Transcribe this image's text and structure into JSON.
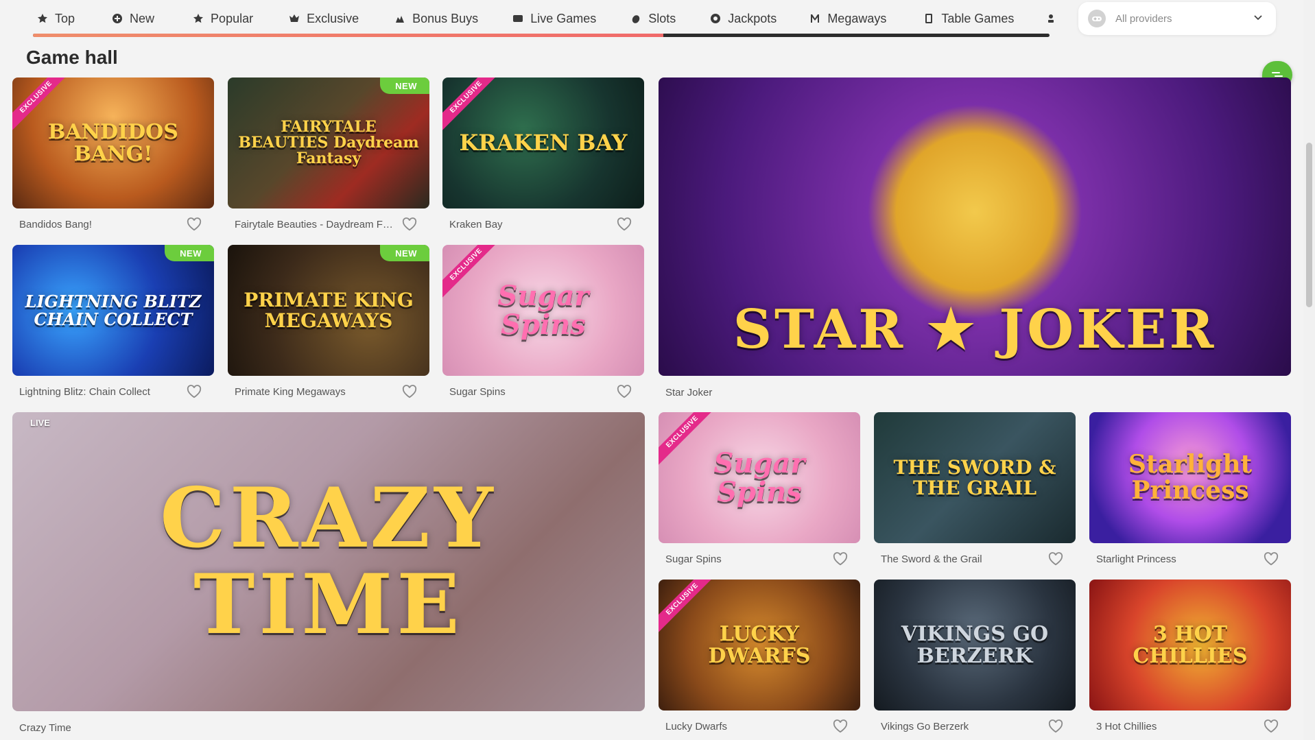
{
  "nav": {
    "tabs": [
      {
        "label": "Top",
        "icon": "star-icon"
      },
      {
        "label": "New",
        "icon": "plus-circle-icon"
      },
      {
        "label": "Popular",
        "icon": "star-icon"
      },
      {
        "label": "Exclusive",
        "icon": "crown-icon"
      },
      {
        "label": "Bonus Buys",
        "icon": "sparkle-icon"
      },
      {
        "label": "Live Games",
        "icon": "camera-icon"
      },
      {
        "label": "Slots",
        "icon": "cherry-icon"
      },
      {
        "label": "Jackpots",
        "icon": "chip-icon"
      },
      {
        "label": "Megaways",
        "icon": "m-icon"
      },
      {
        "label": "Table Games",
        "icon": "card-icon"
      }
    ],
    "progress": 0.62,
    "provider_select": {
      "value": "All providers"
    }
  },
  "heading": "Game hall",
  "badges": {
    "new": "NEW",
    "exclusive": "EXCLUSIVE",
    "live": "LIVE"
  },
  "games": {
    "bandidos": {
      "title": "Bandidos Bang!",
      "art": "BANDIDOS BANG!"
    },
    "fairytale": {
      "title": "Fairytale Beauties - Daydream Fantasy",
      "art": "FAIRYTALE BEAUTIES Daydream Fantasy"
    },
    "kraken": {
      "title": "Kraken Bay",
      "art": "KRAKEN BAY"
    },
    "lightning": {
      "title": "Lightning Blitz: Chain Collect",
      "art": "LIGHTNING BLITZ CHAIN COLLECT"
    },
    "primate": {
      "title": "Primate King Megaways",
      "art": "PRIMATE KING MEGAWAYS"
    },
    "sugar1": {
      "title": "Sugar Spins",
      "art": "Sugar Spins"
    },
    "starjoker": {
      "title": "Star Joker",
      "art": "STAR ★ JOKER"
    },
    "crazytime": {
      "title": "Crazy Time",
      "art": "CRAZY TIME"
    },
    "sugar2": {
      "title": "Sugar Spins",
      "art": "Sugar Spins"
    },
    "sword": {
      "title": "The Sword & the Grail",
      "art": "THE SWORD & THE GRAIL"
    },
    "starlight": {
      "title": "Starlight Princess",
      "art": "Starlight Princess"
    },
    "lucky": {
      "title": "Lucky Dwarfs",
      "art": "LUCKY DWARFS"
    },
    "vikings": {
      "title": "Vikings Go Berzerk",
      "art": "VIKINGS GO BERZERK"
    },
    "chillies": {
      "title": "3 Hot Chillies",
      "art": "3 HOT CHILLIES"
    }
  },
  "colors": {
    "accent_green": "#6ccd3d",
    "exclusive_pink": "#e42a8a",
    "progress_orange": "#ef8d6b"
  }
}
